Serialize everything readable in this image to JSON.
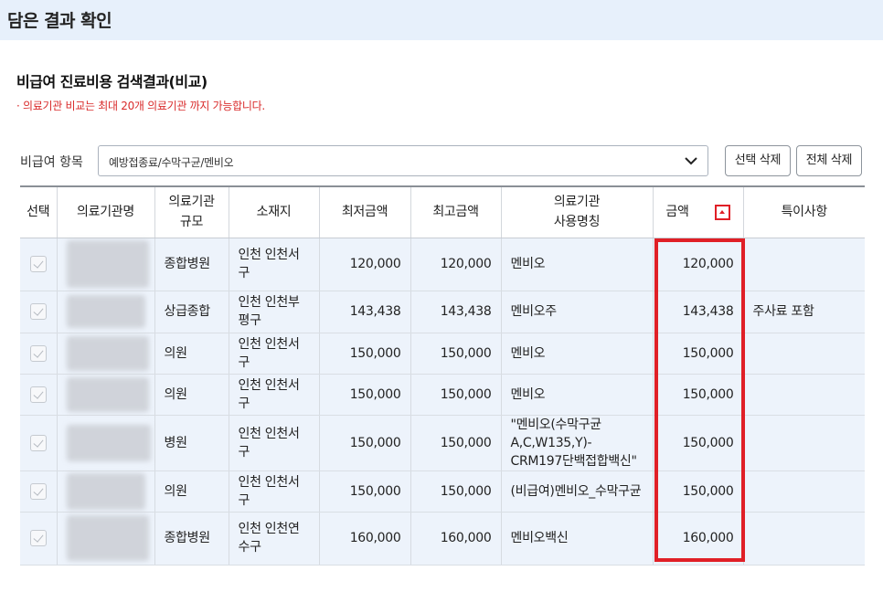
{
  "header": {
    "title": "담은 결과 확인"
  },
  "section": {
    "title": "비급여 진료비용 검색결과(비교)",
    "notice": "· 의료기관 비교는 최대 20개 의료기관 까지 가능합니다."
  },
  "filter": {
    "label": "비급여 항목",
    "selected": "예방접종료/수막구균/멘비오",
    "buttons": {
      "delete_selected": "선택 삭제",
      "delete_all": "전체 삭제"
    }
  },
  "table": {
    "columns": {
      "select": "선택",
      "name": "의료기관명",
      "scale_1": "의료기관",
      "scale_2": "규모",
      "location": "소재지",
      "min": "최저금액",
      "max": "최고금액",
      "usage_1": "의료기관",
      "usage_2": "사용명칭",
      "amount": "금액",
      "note": "특이사항"
    },
    "rows": [
      {
        "scale": "종합병원",
        "location": "인천 인천서구",
        "min": "120,000",
        "max": "120,000",
        "usage": "멘비오",
        "amount": "120,000",
        "note": ""
      },
      {
        "scale": "상급종합",
        "location": "인천 인천부평구",
        "min": "143,438",
        "max": "143,438",
        "usage": "멘비오주",
        "amount": "143,438",
        "note": "주사료 포함"
      },
      {
        "scale": "의원",
        "location": "인천 인천서구",
        "min": "150,000",
        "max": "150,000",
        "usage": "멘비오",
        "amount": "150,000",
        "note": ""
      },
      {
        "scale": "의원",
        "location": "인천 인천서구",
        "min": "150,000",
        "max": "150,000",
        "usage": "멘비오",
        "amount": "150,000",
        "note": ""
      },
      {
        "scale": "병원",
        "location": "인천 인천서구",
        "min": "150,000",
        "max": "150,000",
        "usage": "\"멘비오(수막구균A,C,W135,Y)-CRM197단백접합백신\"",
        "amount": "150,000",
        "note": ""
      },
      {
        "scale": "의원",
        "location": "인천 인천서구",
        "min": "150,000",
        "max": "150,000",
        "usage": "(비급여)멘비오_수막구균",
        "amount": "150,000",
        "note": ""
      },
      {
        "scale": "종합병원",
        "location": "인천 인천연수구",
        "min": "160,000",
        "max": "160,000",
        "usage": "멘비오백신",
        "amount": "160,000",
        "note": ""
      }
    ]
  },
  "colors": {
    "highlight": "#e01f26",
    "row_bg": "#edf3fb",
    "header_bg": "#e7f0fb",
    "notice": "#d92b2b"
  },
  "icons": {
    "sort": "sort-ascending-icon",
    "dropdown": "chevron-down-icon",
    "checkbox": "checkbox-checked-disabled"
  }
}
